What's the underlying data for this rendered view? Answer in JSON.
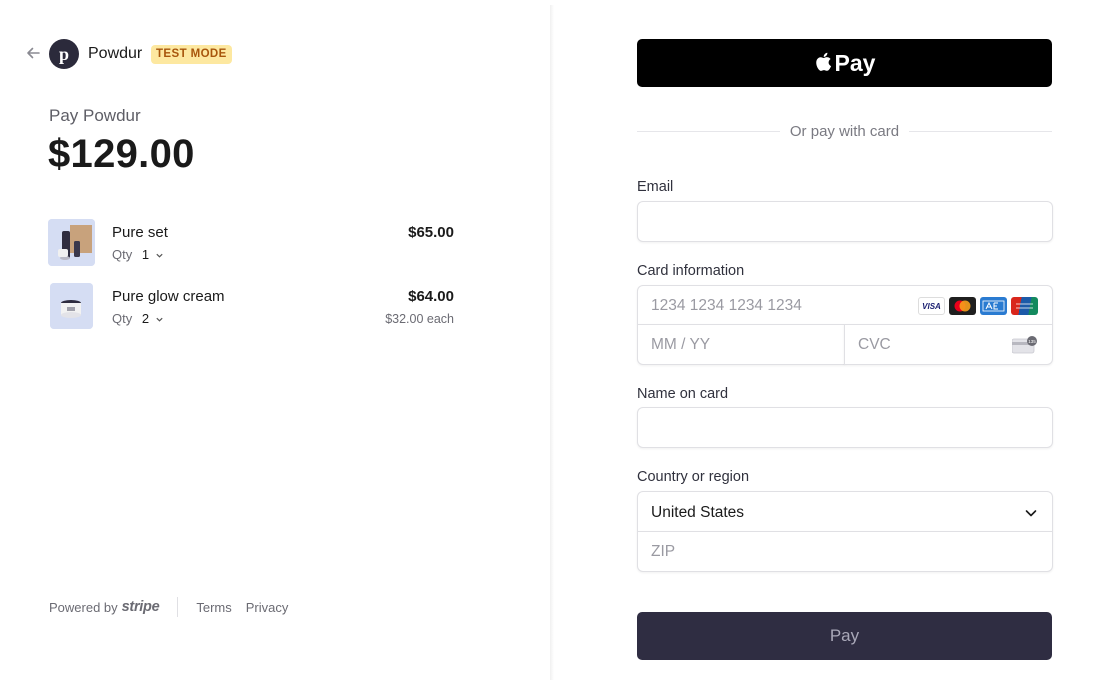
{
  "header": {
    "merchant_initial": "p",
    "merchant_name": "Powdur",
    "badge": "TEST MODE"
  },
  "summary": {
    "pay_label": "Pay Powdur",
    "total": "$129.00"
  },
  "items": [
    {
      "name": "Pure set",
      "qty_label": "Qty",
      "qty": "1",
      "price": "$65.00",
      "each": ""
    },
    {
      "name": "Pure glow cream",
      "qty_label": "Qty",
      "qty": "2",
      "price": "$64.00",
      "each": "$32.00 each"
    }
  ],
  "footer": {
    "powered_by": "Powered by",
    "stripe": "stripe",
    "terms": "Terms",
    "privacy": "Privacy"
  },
  "payment": {
    "apple_pay_label": "Pay",
    "or_text": "Or pay with card",
    "email_label": "Email",
    "email_value": "",
    "card_label": "Card information",
    "card_number_placeholder": "1234 1234 1234 1234",
    "expiry_placeholder": "MM / YY",
    "cvc_placeholder": "CVC",
    "card_brands": [
      "VISA",
      "mastercard",
      "amex",
      "unionpay"
    ],
    "name_label": "Name on card",
    "name_value": "",
    "country_label": "Country or region",
    "country_value": "United States",
    "zip_placeholder": "ZIP",
    "pay_button": "Pay"
  },
  "colors": {
    "accent_dark": "#2f2d42",
    "badge_bg": "#fde8a0",
    "badge_text": "#a8560c"
  }
}
